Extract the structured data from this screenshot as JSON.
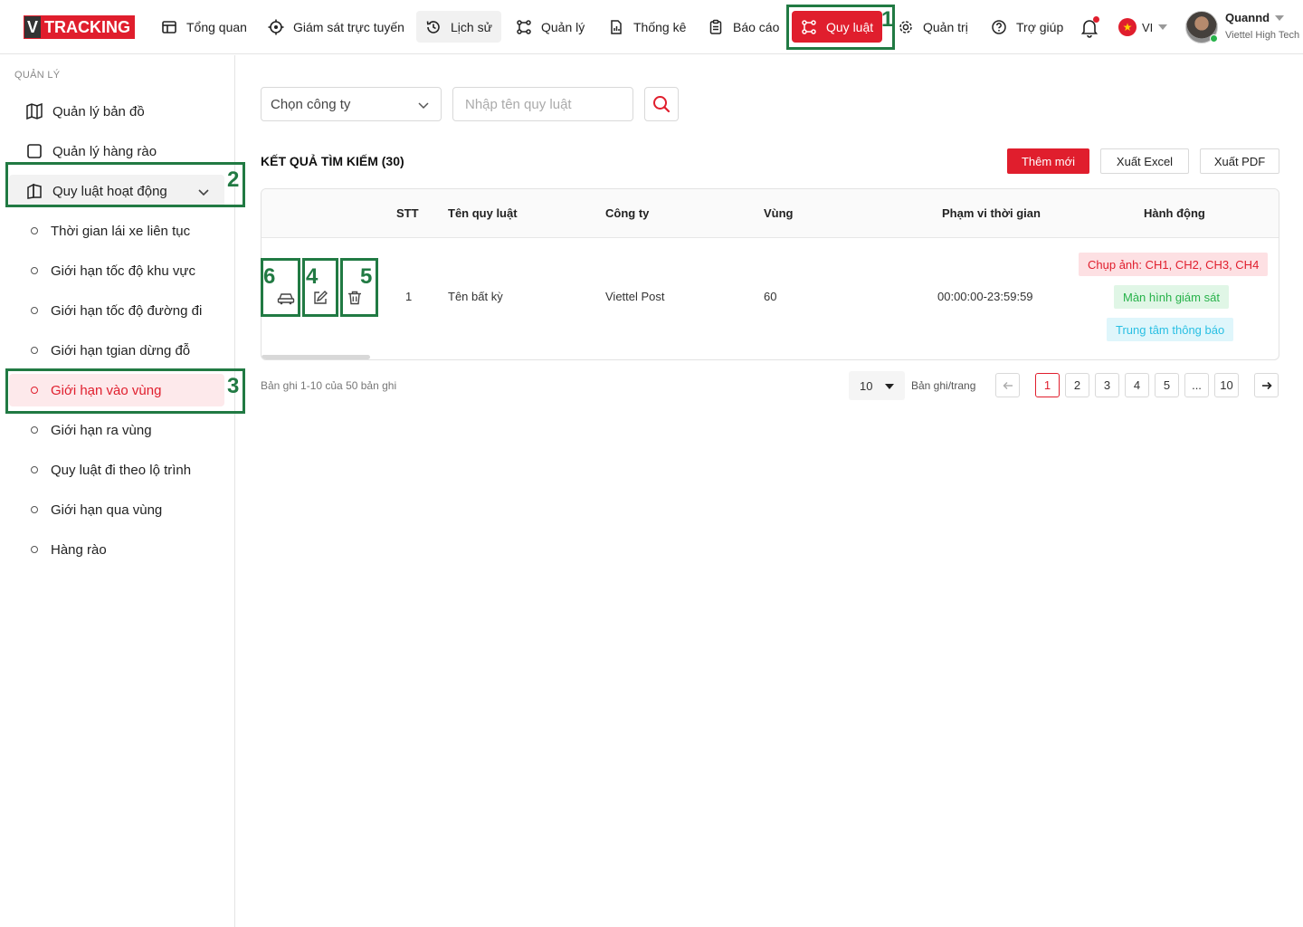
{
  "brand": {
    "v": "V",
    "name": "TRACKING"
  },
  "nav": {
    "overview": "Tổng quan",
    "live": "Giám sát trực tuyến",
    "history": "Lịch sử",
    "manage": "Quản lý",
    "stats": "Thống kê",
    "reports": "Báo cáo",
    "rules": "Quy luật",
    "admin": "Quản trị",
    "help": "Trợ giúp",
    "lang": "VI"
  },
  "user": {
    "name": "Quannd",
    "org": "Viettel High Tech"
  },
  "sidebar": {
    "section": "QUẢN LÝ",
    "items": [
      {
        "label": "Quản lý bản đồ"
      },
      {
        "label": "Quản lý hàng rào"
      },
      {
        "label": "Quy luật hoạt động"
      }
    ],
    "subitems": [
      {
        "label": "Thời gian lái xe liên tục"
      },
      {
        "label": "Giới hạn tốc độ khu vực"
      },
      {
        "label": "Giới hạn tốc độ đường đi"
      },
      {
        "label": "Giới hạn tgian dừng đỗ"
      },
      {
        "label": "Giới hạn vào vùng"
      },
      {
        "label": "Giới hạn ra vùng"
      },
      {
        "label": "Quy luật đi theo lộ trình"
      },
      {
        "label": "Giới hạn qua vùng"
      },
      {
        "label": "Hàng rào"
      }
    ]
  },
  "filters": {
    "company_placeholder": "Chọn công ty",
    "rule_placeholder": "Nhập tên quy luật"
  },
  "results": {
    "title": "KẾT QUẢ TÌM KIẾM (30)",
    "add_label": "Thêm mới",
    "excel_label": "Xuất Excel",
    "pdf_label": "Xuất PDF"
  },
  "table": {
    "headers": {
      "stt": "STT",
      "name": "Tên quy luật",
      "company": "Công ty",
      "zone": "Vùng",
      "time_range": "Phạm vi thời gian",
      "actions": "Hành động"
    },
    "rows": [
      {
        "stt": "1",
        "name": "Tên bất kỳ",
        "company": "Viettel Post",
        "zone": "60",
        "time_range": "00:00:00-23:59:59",
        "tags": [
          "Chụp ảnh: CH1, CH2, CH3, CH4",
          "Màn hình giám sát",
          "Trung tâm thông báo"
        ]
      }
    ]
  },
  "annotations": {
    "a1": "1",
    "a2": "2",
    "a3": "3",
    "a4": "4",
    "a5": "5",
    "a6": "6"
  },
  "pagination": {
    "info": "Bản ghi 1-10 của 50 bản ghi",
    "page_size": "10",
    "per_page_label": "Bản ghi/trang",
    "pages": [
      "1",
      "2",
      "3",
      "4",
      "5",
      "...",
      "10"
    ],
    "current": "1"
  },
  "colors": {
    "accent": "#e01e2d",
    "annotation": "#217a43",
    "success": "#27b24a",
    "info": "#29bfe3"
  }
}
